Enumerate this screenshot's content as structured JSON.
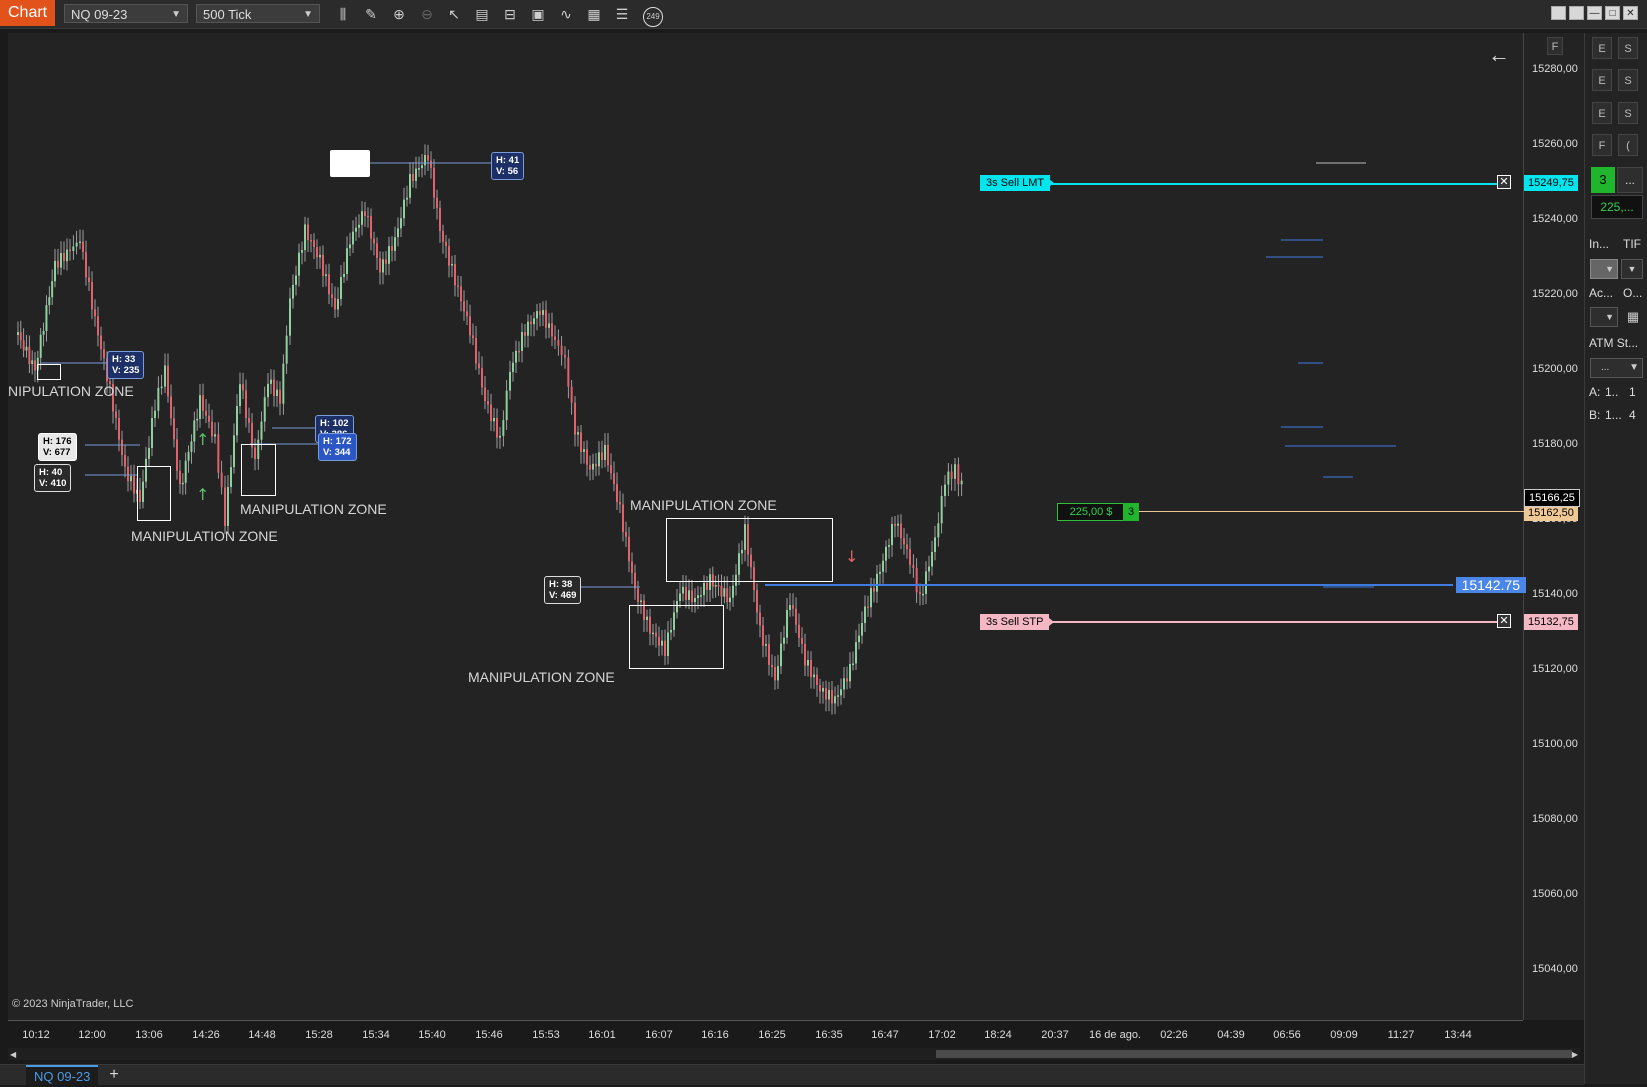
{
  "app": {
    "tab_label": "Chart"
  },
  "toolbar": {
    "instrument": "NQ 09-23",
    "interval": "500 Tick",
    "icons": [
      "bar-chart-icon",
      "pencil-icon",
      "zoom-in-icon",
      "zoom-out-icon",
      "pointer-icon",
      "properties-icon",
      "templates-icon",
      "data-box-icon",
      "indicators-icon",
      "strategies-icon",
      "list-icon"
    ],
    "badge": "249"
  },
  "window_buttons": [
    "tile-icon",
    "tile-icon",
    "minimize-icon",
    "maximize-icon",
    "close-icon"
  ],
  "price_axis": {
    "ticks": [
      "15280,00",
      "15260,00",
      "15240,00",
      "15220,00",
      "15200,00",
      "15180,00",
      "15160,00",
      "15140,00",
      "15120,00",
      "15100,00",
      "15080,00",
      "15060,00",
      "15040,00"
    ],
    "last_price": "15166,25",
    "avg_price": "15162,50",
    "sell_lmt": "15249,75",
    "sell_stp": "15132,75",
    "hline_price": "15142.75"
  },
  "time_axis": {
    "ticks": [
      "10:12",
      "12:00",
      "13:06",
      "14:26",
      "14:48",
      "15:28",
      "15:34",
      "15:40",
      "15:46",
      "15:53",
      "16:01",
      "16:07",
      "16:16",
      "16:25",
      "16:35",
      "16:47",
      "17:02",
      "18:24",
      "20:37",
      "16 de ago.",
      "02:26",
      "04:39",
      "06:56",
      "09:09",
      "11:27",
      "13:44"
    ]
  },
  "orders": {
    "sell_lmt_label": "3s  Sell LMT",
    "sell_stp_label": "3s  Sell STP",
    "position_pnl": "225,00 $",
    "position_qty": "3"
  },
  "annotations": {
    "zone_label": "MANIPULATION ZONE",
    "zone_label_cut": "NIPULATION ZONE",
    "hv": [
      {
        "h": "H: 41",
        "v": "V: 56"
      },
      {
        "h": "H: 33",
        "v": "V: 235"
      },
      {
        "h": "H: 176",
        "v": "V: 677"
      },
      {
        "h": "H: 40",
        "v": "V: 410"
      },
      {
        "h": "H: 102",
        "v": "V: 386"
      },
      {
        "h": "H: 172",
        "v": "V: 344"
      },
      {
        "h": "H: 38",
        "v": "V: 469"
      }
    ]
  },
  "copyright": "© 2023 NinjaTrader, LLC",
  "panel": {
    "qty": "3",
    "more": "...",
    "pnl": "225,...",
    "instrument_label": "In...",
    "tif_label": "TIF",
    "account_label": "Ac...",
    "o_label": "O...",
    "atm_label": "ATM St...",
    "atm_value": "...",
    "a_label": "A:",
    "a_val1": "1..",
    "a_val2": "1",
    "b_label": "B:",
    "b_val1": "1...",
    "b_val2": "4",
    "btns": [
      "E",
      "S",
      "E",
      "S",
      "E",
      "S",
      "F",
      "("
    ],
    "f_btn": "F"
  },
  "bottom_tab": {
    "label": "NQ 09-23",
    "add": "+"
  },
  "colors": {
    "accent": "#e2531c",
    "cyan": "#00e5ee",
    "pink": "#f4b8c4",
    "blue_line": "#3f7be0",
    "gold": "#f0c896",
    "up": "#8fd19e",
    "down": "#e0626b"
  }
}
